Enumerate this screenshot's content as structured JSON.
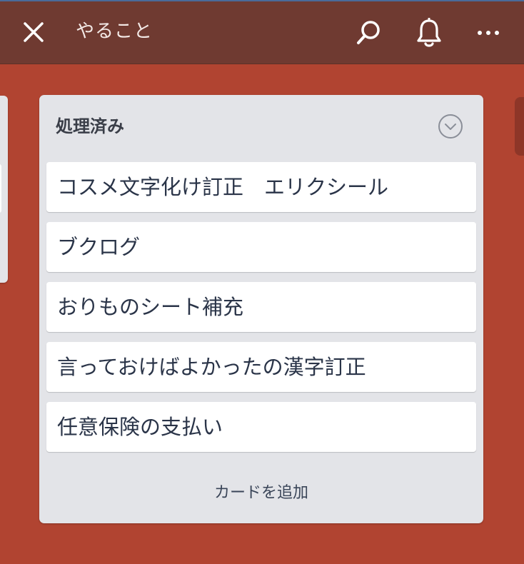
{
  "header": {
    "title": "やること",
    "icons": [
      "close-icon",
      "search-icon",
      "bell-icon",
      "more-icon"
    ]
  },
  "list": {
    "title": "処理済み",
    "menu_icon": "chevron-down-icon",
    "cards": [
      {
        "title": "コスメ文字化け訂正　エリクシール"
      },
      {
        "title": "ブクログ"
      },
      {
        "title": "おりものシート補充"
      },
      {
        "title": "言っておけばよかったの漢字訂正"
      },
      {
        "title": "任意保険の支払い"
      }
    ],
    "add_card_label": "カードを追加"
  },
  "colors": {
    "board_background": "#b14431",
    "header_background": "#6f3a31",
    "list_background": "#e3e4e8",
    "card_background": "#ffffff",
    "card_text": "#2a3448"
  }
}
